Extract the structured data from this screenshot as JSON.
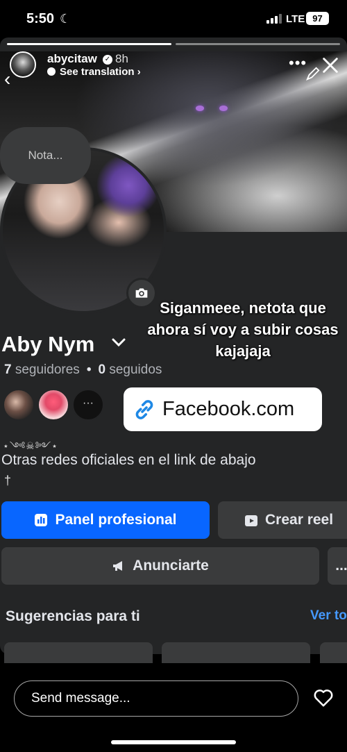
{
  "status_bar": {
    "time": "5:50",
    "network": "LTE",
    "battery": "97"
  },
  "story": {
    "username": "abycitaw",
    "time_ago": "8h",
    "translation_label": "See translation"
  },
  "profile": {
    "note_placeholder": "Nota...",
    "caption": "Siganmeee, netota que ahora sí voy a subir cosas kajajaja",
    "name": "Aby Nym",
    "followers_count": "7",
    "followers_label": "seguidores",
    "following_count": "0",
    "following_label": "seguidos",
    "link_text": "Facebook.com",
    "ornament": "⋆༺☠༻⋆",
    "bio": "Otras redes oficiales en el link de abajo",
    "bio_symbol": "†"
  },
  "actions": {
    "primary_label": "Panel profesional",
    "reel_label": "Crear reel",
    "ads_label": "Anunciarte",
    "more_label": "..."
  },
  "suggestions": {
    "title": "Sugerencias para ti",
    "see_all": "Ver to"
  },
  "composer": {
    "placeholder": "Send message..."
  },
  "colors": {
    "accent": "#0866ff",
    "link": "#4599ff",
    "surface": "#242526",
    "button_bg": "#3a3b3c"
  },
  "icons": [
    "back-arrow-icon",
    "more-icon",
    "pencil-icon",
    "close-icon",
    "verified-icon",
    "camera-icon",
    "chevron-down-icon",
    "link-icon",
    "chart-icon",
    "reel-icon",
    "megaphone-icon",
    "heart-icon"
  ]
}
